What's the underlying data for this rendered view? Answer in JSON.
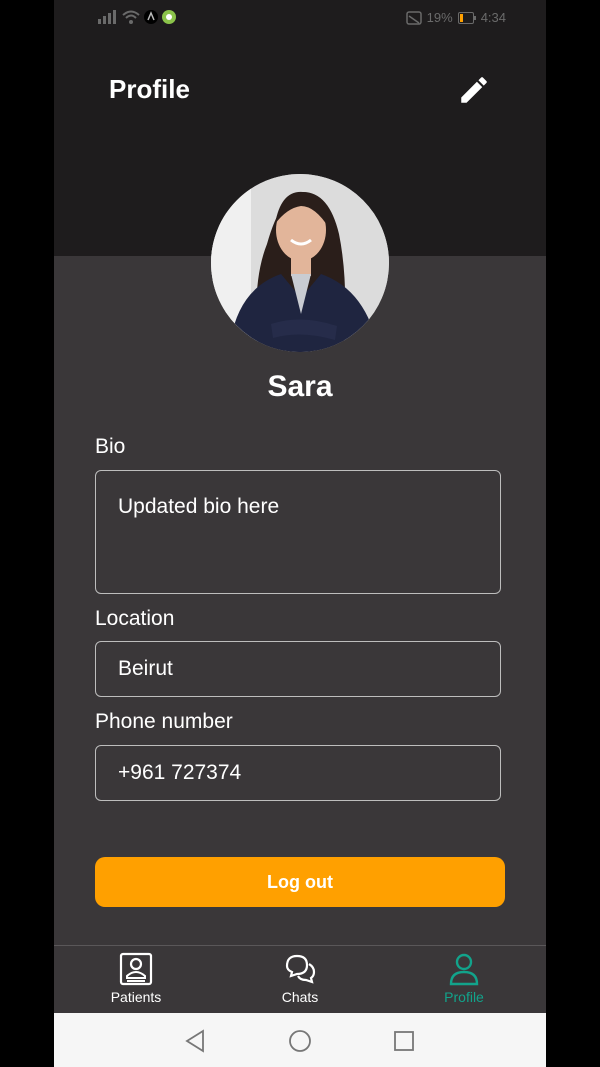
{
  "status_bar": {
    "battery": "19%",
    "time": "4:34"
  },
  "header": {
    "title": "Profile",
    "edit_icon": "pencil-icon"
  },
  "profile": {
    "name": "Sara",
    "bio_label": "Bio",
    "bio_value": "Updated bio here",
    "location_label": "Location",
    "location_value": "Beirut",
    "phone_label": "Phone number",
    "phone_value": "+961 727374"
  },
  "logout_label": "Log out",
  "tabs": [
    {
      "label": "Patients",
      "icon": "patient-card-icon",
      "active": false
    },
    {
      "label": "Chats",
      "icon": "chat-bubbles-icon",
      "active": false
    },
    {
      "label": "Profile",
      "icon": "person-icon",
      "active": true
    }
  ],
  "colors": {
    "accent": "#ffa000",
    "active_tab": "#12a38b",
    "header_bg": "#1e1c1d",
    "body_bg": "#3a3739"
  }
}
